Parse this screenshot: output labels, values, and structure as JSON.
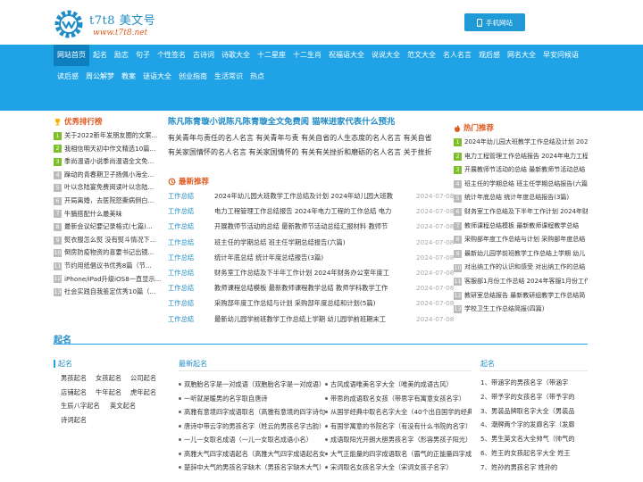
{
  "header": {
    "logo_name": "t7t8 美文号",
    "logo_url": "www.t7t8.net",
    "mobile_button": "手机网站"
  },
  "nav": {
    "row1": [
      "网站首页",
      "起名",
      "励志",
      "句子",
      "个性签名",
      "古诗词",
      "诗歌大全",
      "十二星座",
      "十二生肖",
      "祝福语大全",
      "说说大全",
      "范文大全",
      "名人名言",
      "观后感",
      "网名大全",
      "早安问候语"
    ],
    "row2": [
      "读后感",
      "周公解梦",
      "教案",
      "谜语大全",
      "创业指南",
      "生活常识",
      "热点"
    ]
  },
  "ranking": {
    "title": "优秀排行榜",
    "items": [
      {
        "num": "1",
        "text": "关于2022新年发朋友圈的文案..."
      },
      {
        "num": "2",
        "text": "我相信明天初中作文精选10篇..."
      },
      {
        "num": "3",
        "text": "季尚温语小说季尚温语全文免..."
      },
      {
        "num": "4",
        "text": "躁动的青春期卫子扬佩小海全..."
      },
      {
        "num": "5",
        "text": "叶以念陆宴免费阅读叶以念陆..."
      },
      {
        "num": "6",
        "text": "开局离婚，去医院怒撕病例白..."
      },
      {
        "num": "7",
        "text": "牛腩搭配什么最美味"
      },
      {
        "num": "8",
        "text": "最新会议纪要记录格式(七篇)..."
      },
      {
        "num": "9",
        "text": "熨衣服怎么熨 没有熨斗情况下..."
      },
      {
        "num": "10",
        "text": "倒房防疫物资的喜要书记出镜..."
      },
      {
        "num": "11",
        "text": "节约用纸倡议书优秀8篇（节..."
      },
      {
        "num": "12",
        "text": "iPhone/iPad升级iOS8一直显示..."
      },
      {
        "num": "13",
        "text": "社会实践自我鉴定优秀10篇（..."
      }
    ]
  },
  "main": {
    "headline": "陈凡陈青璇小说陈凡陈青璇全文免费阅 猫咪进家代表什么预兆",
    "desc1": "有关青年与责任的名人名言 有关青年与责  有关自省的人生态度的名人名言 有关自省",
    "desc2": "有关家国情怀的名人名言 有关家国情怀的  有关有关挫折和磨砺的名人名言 关于挫折",
    "latest_title": "最新推荐",
    "posts": [
      {
        "cat": "工作总结",
        "title": "2024年幼儿园大班教学工作总结及计划 2024年幼儿园大班教",
        "date": "2024-07-08"
      },
      {
        "cat": "工作总结",
        "title": "电力工程管理工作总结报告 2024年电力工程的工作总结 电力",
        "date": "2024-07-08"
      },
      {
        "cat": "工作总结",
        "title": "开展教师节活动的总结 最新教师节活动总结汇报材料 教师节",
        "date": "2024-07-08"
      },
      {
        "cat": "工作总结",
        "title": "班主任的学期总结 班主任学期总结报告(六篇)",
        "date": "2024-07-08"
      },
      {
        "cat": "工作总结",
        "title": "统计年底总结 统计年度总结报告(3篇)",
        "date": "2024-07-08"
      },
      {
        "cat": "工作总结",
        "title": "财务室工作总结及下半年工作计划 2024年财务办公室年度工",
        "date": "2024-07-08"
      },
      {
        "cat": "工作总结",
        "title": "教师课程总结模板 最新教师课程教学总结 教师学科教学工作",
        "date": "2024-07-08"
      },
      {
        "cat": "工作总结",
        "title": "采购部年度工作总结与计划 采购部年度总结和计划(5篇)",
        "date": "2024-07-08"
      },
      {
        "cat": "工作总结",
        "title": "最新幼儿园学前班教学工作总结上学期 幼儿园学前班期末工",
        "date": "2024-07-08"
      }
    ]
  },
  "hot": {
    "title": "热门推荐",
    "items": [
      {
        "num": "1",
        "text": "2024年幼儿园大班教学工作总结及计划 2024"
      },
      {
        "num": "2",
        "text": "电力工程管理工作总结报告 2024年电力工程"
      },
      {
        "num": "3",
        "text": "开展教师节活动的总结 最新教师节活动总结"
      },
      {
        "num": "4",
        "text": "班主任的学期总结 班主任学期总结报告(六篇)"
      },
      {
        "num": "5",
        "text": "统计年底总结 统计年度总结报告(3篇)"
      },
      {
        "num": "6",
        "text": "财务室工作总结及下半年工作计划 2024年财"
      },
      {
        "num": "7",
        "text": "教师课程总结模板 最新教师课程教学总结"
      },
      {
        "num": "8",
        "text": "采购部年度工作总结与计划 采购部年度总结"
      },
      {
        "num": "9",
        "text": "最新幼儿园学前班教学工作总结上学期 幼儿"
      },
      {
        "num": "10",
        "text": "对出纳工作的认识和感受 对出纳工作的总结"
      },
      {
        "num": "11",
        "text": "客服部1月份工作总结 2024年客服1月份工作"
      },
      {
        "num": "12",
        "text": "教研室总结报告 最新教研组教学工作总结简"
      },
      {
        "num": "13",
        "text": "学校卫生工作总结简报(四篇)"
      }
    ]
  },
  "qiming": {
    "section_title": "起名",
    "sub_title": "起名",
    "tags": [
      "男孩起名",
      "女孩起名",
      "公司起名",
      "店铺起名",
      "牛年起名",
      "虎年起名",
      "生辰八字起名",
      "英文起名",
      "诗词起名"
    ],
    "mid_title": "最新起名",
    "names": [
      "双胞胎名字是一对成语（双胞胎名字是一对成语）",
      "古风成语唯美名字大全（唯美的成语古风）",
      "一听就是暖男的名字取自唐诗",
      "带思的成语取名女孩（带思字有寓意女孩名字）",
      "高雅有意境四字成语取名（高雅有意境的四字诗句）",
      "从国学经典中取名名字大全（40个出自国学的经典好名字）",
      "唐诗中带云字的男孩名字（姓云的男孩名字古韵）",
      "有国学寓意的书院名字（有没有什么书院的名字）",
      "一儿一女取名成语（一儿一女取名成语小名）",
      "成语取阳光开朗大胆男孩名字（形容男孩子阳光）",
      "高雅大气四字成语起名（高雅大气四字成语起名女孩）",
      "大气正能量的四字成语取名（霸气的正能量四字成语）",
      "楚辞中大气的男孩名字缺木（男孩名字缺木大气）",
      "宋词取名女孩名字大全（宋词女孩子名字）"
    ],
    "right_title": "起名",
    "right_items": [
      {
        "num": "1、",
        "text": "带涵字的男孩名字（带涵字"
      },
      {
        "num": "2、",
        "text": "带予字的女孩名字（带予字的"
      },
      {
        "num": "3、",
        "text": "男装品牌取名字大全（男装品"
      },
      {
        "num": "4、",
        "text": "潮牌两个字的发廊名字（发廊"
      },
      {
        "num": "5、",
        "text": "男生英文名大全帅气（帅气的"
      },
      {
        "num": "6、",
        "text": "姓王的女孩起名字大全 姓王"
      },
      {
        "num": "7、",
        "text": "姓孙的男孩名字 姓孙的"
      }
    ]
  }
}
